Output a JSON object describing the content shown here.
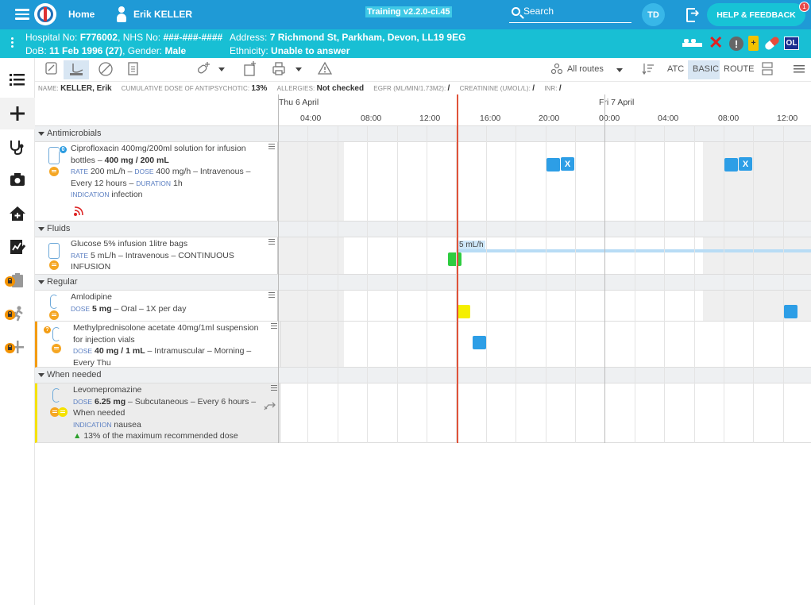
{
  "topbar": {
    "home_label": "Home",
    "user_name": "Erik KELLER",
    "version": "Training v2.2.0-ci.45",
    "search_placeholder": "Search",
    "initials": "TD",
    "help_label": "HELP & FEEDBACK",
    "notification_count": "1"
  },
  "patient": {
    "line1": {
      "hospital_no_label": "Hospital No:",
      "hospital_no": "F776002",
      "nhs_no_label": ", NHS No:",
      "nhs_no": "###-###-####",
      "address_label": "Address:",
      "address": "7 Richmond St, Parkham, Devon, LL19 9EG"
    },
    "line2": {
      "dob_label": "DoB:",
      "dob": "11 Feb 1996 (27)",
      "gender_label": ", Gender:",
      "gender": "Male",
      "ethnicity_label": "Ethnicity:",
      "ethnicity": "Unable to answer"
    },
    "battery_label": "+",
    "ol_label": "OL"
  },
  "toolbar": {
    "routes_label": "All routes",
    "atc_label": "ATC",
    "basic_label": "BASIC",
    "route_label": "ROUTE"
  },
  "infostrip": {
    "name_key": "Name:",
    "name_val": "KELLER, Erik",
    "dose_key": "Cumulative dose of antipsychotic:",
    "dose_val": "13%",
    "allergies_key": "Allergies:",
    "allergies_val": "Not checked",
    "egfr_key": "eGFR (mL/min/1.73m2):",
    "egfr_val": "/",
    "creat_key": "Creatinine (umol/L):",
    "creat_val": "/",
    "inr_key": "INR:",
    "inr_val": "/"
  },
  "timeline": {
    "days": [
      "Thu 6 April",
      "Fri 7 April"
    ],
    "ticks": [
      "04:00",
      "08:00",
      "12:00",
      "16:00",
      "20:00",
      "00:00",
      "04:00",
      "08:00",
      "12:00"
    ]
  },
  "sections": {
    "antimicrobials": "Antimicrobials",
    "fluids": "Fluids",
    "regular": "Regular",
    "when_needed": "When needed"
  },
  "meds": {
    "cipro": {
      "name": "Ciprofloxacin 400mg/200ml solution for infusion bottles – ",
      "strength": "400 mg / 200 mL",
      "rate_key": "Rate",
      "rate": " 200 mL/h – ",
      "dose_key": "Dose",
      "dose": " 400 mg/h – Intravenous – Every 12 hours – ",
      "duration_key": "Duration",
      "duration": " 1h",
      "indication_key": "Indication",
      "indication": " infection",
      "badge": "0",
      "given_mark": "X"
    },
    "glucose": {
      "name": "Glucose 5% infusion 1litre bags",
      "rate_key": "Rate",
      "rate": " 5 mL/h – Intravenous – CONTINUOUS INFUSION",
      "rate_tag": "5 mL/h"
    },
    "amlodipine": {
      "name": "Amlodipine",
      "dose_key": "Dose",
      "dose": "5 mg",
      "rest": " – Oral – 1X per day"
    },
    "methylpred": {
      "name": "Methylprednisolone acetate 40mg/1ml suspension for injection vials",
      "dose_key": "Dose",
      "dose": "40 mg / 1 mL",
      "rest": " – Intramuscular – Morning – Every Thu",
      "badge": "?"
    },
    "levomepromazine": {
      "name": "Levomepromazine",
      "dose_key": "Dose",
      "dose": "6.25 mg",
      "rest": " – Subcutaneous – Every 6 hours – When needed",
      "indication_key": "Indication",
      "indication": " nausea",
      "warning": "13% of the maximum recommended dose"
    }
  },
  "colors": {
    "topbar": "#1f9ad6",
    "patient_banner": "#18bfd4",
    "now_line": "#e0533a",
    "admin_due": "#2d9ee6",
    "infusion_start": "#2ecc40",
    "due_now": "#f5ef00"
  }
}
